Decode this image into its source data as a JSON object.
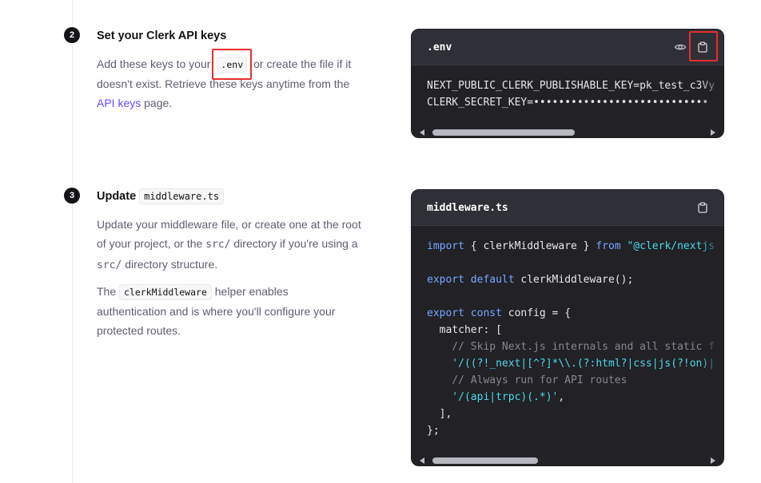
{
  "step2": {
    "number": "2",
    "title": "Set your Clerk API keys",
    "para_before": "Add these keys to your ",
    "code_env": ".env",
    "para_after_1": " or create the file if it",
    "para_line2": "doesn't exist. Retrieve these keys anytime from the",
    "link": "API keys",
    "para_end": " page.",
    "panel": {
      "filename": ".env",
      "line1": "NEXT_PUBLIC_CLERK_PUBLISHABLE_KEY=pk_test_c3Vy",
      "line2_label": "CLERK_SECRET_KEY=",
      "line2_masked": "••••••••••••••••••••••••••••",
      "scroll_fraction": 0.5
    }
  },
  "step3": {
    "number": "3",
    "title": "Update",
    "title_code": "middleware.ts",
    "p1_a": "Update your middleware file, or create one at the root",
    "p1_b": "of your project, or the ",
    "p1_code1": "src/",
    "p1_c": " directory if you're using a",
    "p1_code2": "src/",
    "p1_d": " directory structure.",
    "p2_a": "The ",
    "p2_code": "clerkMiddleware",
    "p2_b": " helper enables",
    "p2_c": "authentication and is where you'll configure your",
    "p2_d": "protected routes.",
    "panel": {
      "filename": "middleware.ts",
      "c1_kw1": "import",
      "c1_mid": " { clerkMiddleware } ",
      "c1_kw2": "from",
      "c1_str": " \"@clerk/nextjs",
      "c2_kw": "export default",
      "c2_rest": " clerkMiddleware();",
      "c3_kw": "export const",
      "c3_rest": " config = {",
      "c4": "  matcher: [",
      "c5": "    // Skip Next.js internals and all static f",
      "c6": "    '/((?!_next|[^?]*\\\\.(?:html?|css|js(?!on)|",
      "c7": "    // Always run for API routes",
      "c8_str": "    '/(api|trpc)(.*)'",
      "c8_rest": ",",
      "c9": "  ],",
      "c10": "};",
      "scroll_fraction": 0.4
    }
  },
  "icons": {
    "eye": "eye-icon",
    "copy": "clipboard-icon"
  },
  "colors": {
    "accent_link": "#6c47ff",
    "highlight": "#e62e2e",
    "panel_bg": "#2f3037",
    "code_bg": "#212126"
  }
}
